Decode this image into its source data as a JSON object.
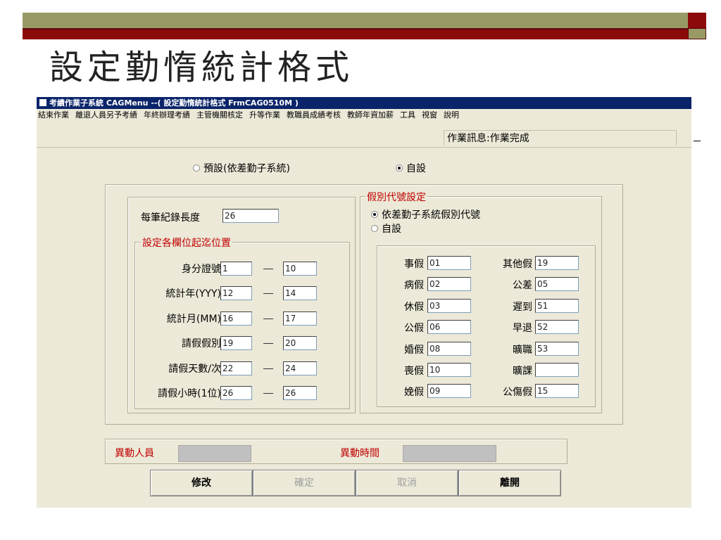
{
  "slide": {
    "title": "設定勤惰統計格式"
  },
  "window": {
    "title": "考績作業子系統 CAGMenu --( 設定勤惰統計格式 FrmCAG0510M )"
  },
  "menu": [
    "結束作業",
    "離退人員另予考績",
    "年終辦理考績",
    "主管機關核定",
    "升等作業",
    "教職員成績考核",
    "教師年資加薪",
    "工具",
    "視窗",
    "說明"
  ],
  "status": {
    "message": "作業訊息:作業完成"
  },
  "mode": {
    "default_label": "預設(依差勤子系統)",
    "custom_label": "自設",
    "selected": "custom"
  },
  "record_length": {
    "label": "每筆紀錄長度",
    "value": "26"
  },
  "positions": {
    "legend": "設定各欄位起迄位置",
    "rows": [
      {
        "label": "身分證號",
        "start": "1",
        "end": "10"
      },
      {
        "label": "統計年(YYY)",
        "start": "12",
        "end": "14"
      },
      {
        "label": "統計月(MM)",
        "start": "16",
        "end": "17"
      },
      {
        "label": "請假假別",
        "start": "19",
        "end": "20"
      },
      {
        "label": "請假天數/次",
        "start": "22",
        "end": "24"
      },
      {
        "label": "請假小時(1位)",
        "start": "26",
        "end": "26"
      }
    ]
  },
  "leave_codes": {
    "legend": "假別代號設定",
    "option_system": "依差勤子系統假別代號",
    "option_custom": "自設",
    "selected": "system",
    "left": [
      {
        "label": "事假",
        "value": "01"
      },
      {
        "label": "病假",
        "value": "02"
      },
      {
        "label": "休假",
        "value": "03"
      },
      {
        "label": "公假",
        "value": "06"
      },
      {
        "label": "婚假",
        "value": "08"
      },
      {
        "label": "喪假",
        "value": "10"
      },
      {
        "label": "娩假",
        "value": "09"
      }
    ],
    "right": [
      {
        "label": "其他假",
        "value": "19"
      },
      {
        "label": "公差",
        "value": "05"
      },
      {
        "label": "遲到",
        "value": "51"
      },
      {
        "label": "早退",
        "value": "52"
      },
      {
        "label": "曠職",
        "value": "53"
      },
      {
        "label": "曠課",
        "value": ""
      },
      {
        "label": "公傷假",
        "value": "15"
      }
    ]
  },
  "audit": {
    "changed_by_label": "異動人員",
    "changed_at_label": "異動時間"
  },
  "buttons": {
    "modify": "修改",
    "confirm": "確定",
    "cancel": "取消",
    "exit": "離開"
  }
}
